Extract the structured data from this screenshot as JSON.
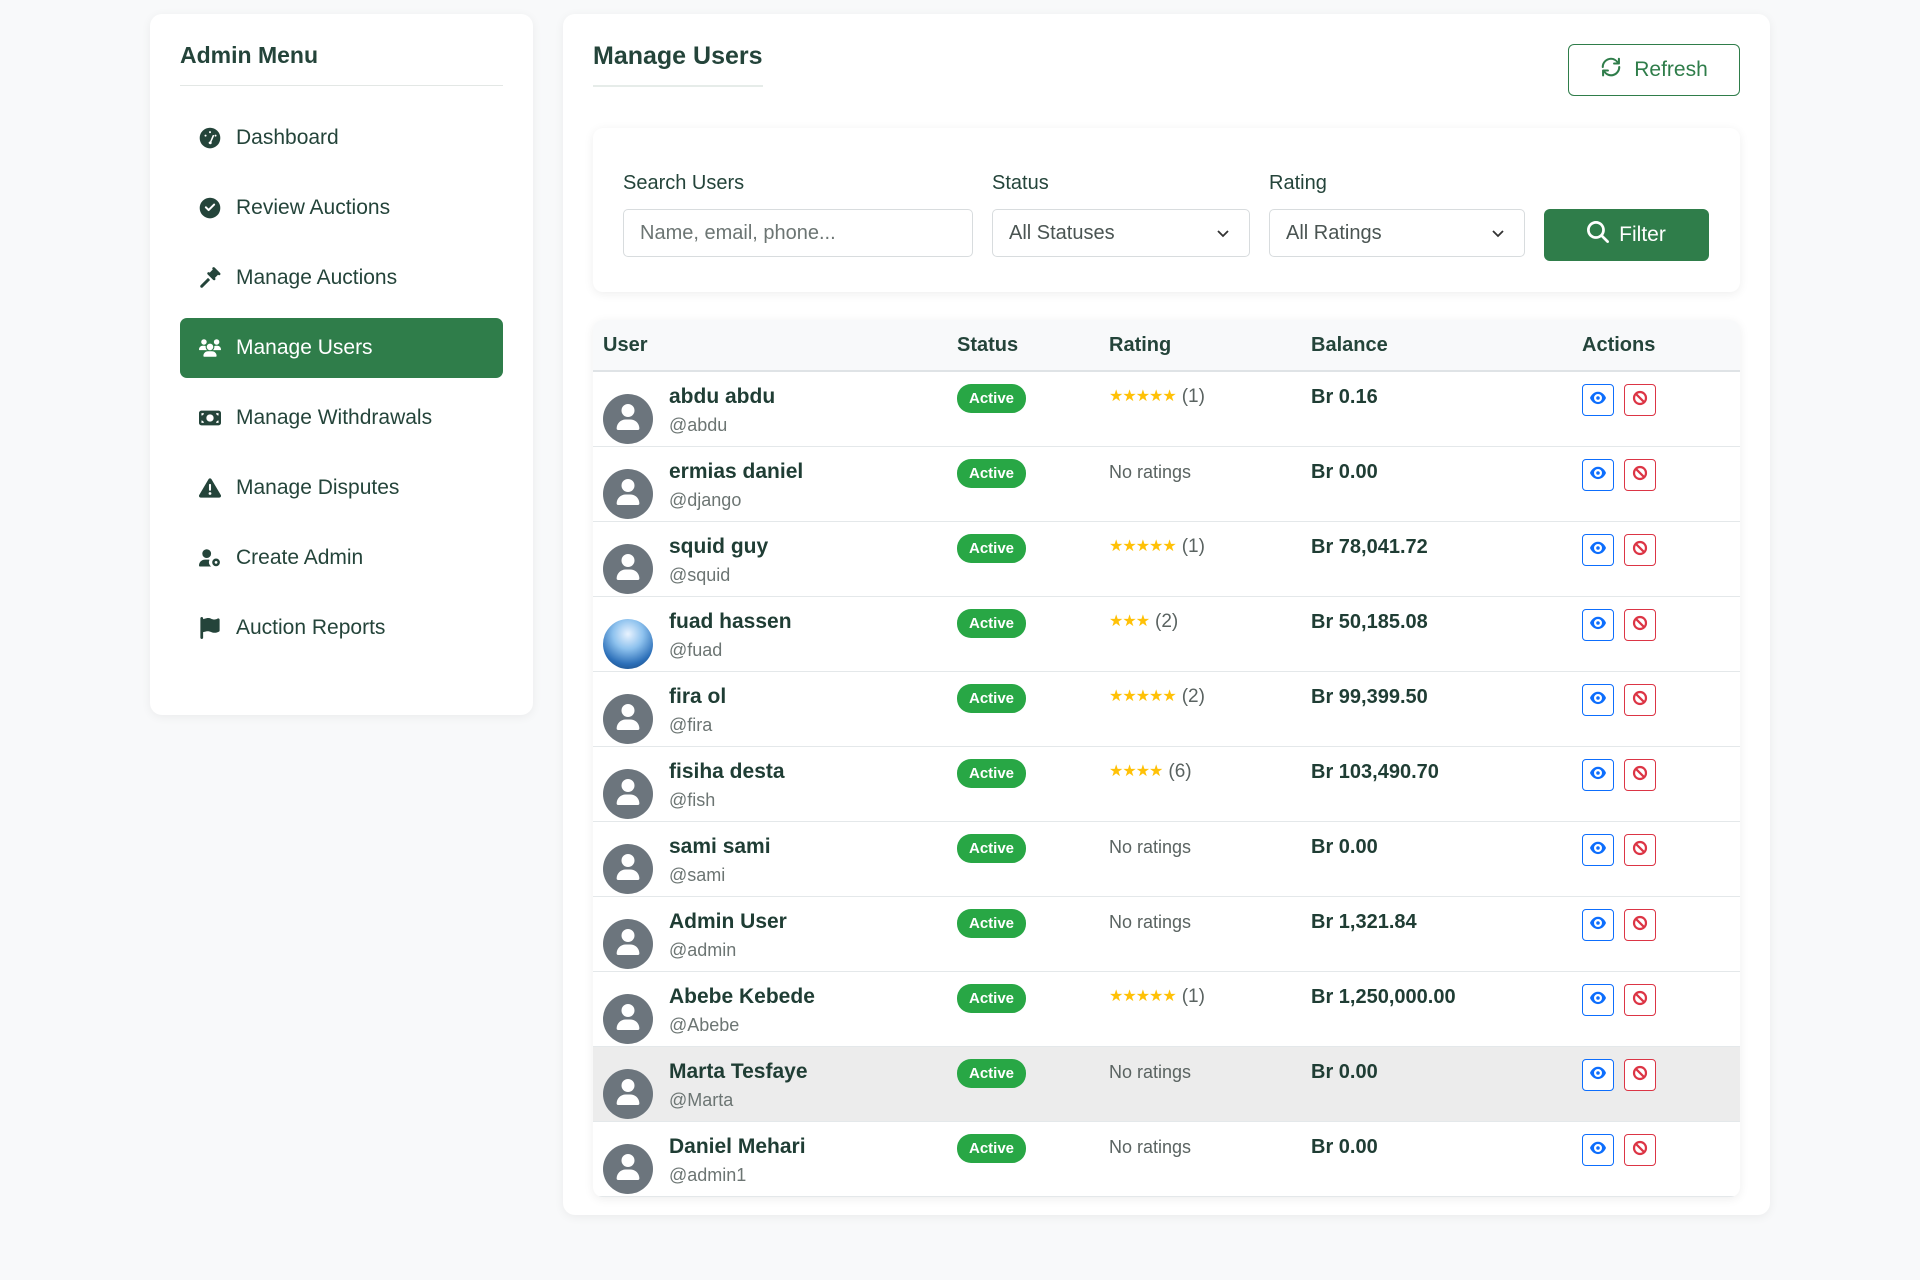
{
  "sidebar": {
    "title": "Admin Menu",
    "items": [
      {
        "label": "Dashboard",
        "icon": "dashboard-icon",
        "active": false
      },
      {
        "label": "Review Auctions",
        "icon": "check-circle-icon",
        "active": false
      },
      {
        "label": "Manage Auctions",
        "icon": "gavel-icon",
        "active": false
      },
      {
        "label": "Manage Users",
        "icon": "users-icon",
        "active": true
      },
      {
        "label": "Manage Withdrawals",
        "icon": "money-icon",
        "active": false
      },
      {
        "label": "Manage Disputes",
        "icon": "warning-icon",
        "active": false
      },
      {
        "label": "Create Admin",
        "icon": "user-cog-icon",
        "active": false
      },
      {
        "label": "Auction Reports",
        "icon": "flag-icon",
        "active": false
      }
    ]
  },
  "main": {
    "title": "Manage Users",
    "refresh_label": "Refresh"
  },
  "filters": {
    "search_label": "Search Users",
    "search_placeholder": "Name, email, phone...",
    "status_label": "Status",
    "status_value": "All Statuses",
    "rating_label": "Rating",
    "rating_value": "All Ratings",
    "filter_label": "Filter"
  },
  "table": {
    "headers": {
      "user": "User",
      "status": "Status",
      "rating": "Rating",
      "balance": "Balance",
      "actions": "Actions"
    },
    "rows": [
      {
        "name": "abdu abdu",
        "handle": "@abdu",
        "status": "Active",
        "stars": "★★★★★",
        "rating_count": "(1)",
        "no_ratings": "",
        "balance": "Br 0.16",
        "avatar": "default"
      },
      {
        "name": "ermias daniel",
        "handle": "@django",
        "status": "Active",
        "stars": "",
        "rating_count": "",
        "no_ratings": "No ratings",
        "balance": "Br 0.00",
        "avatar": "default"
      },
      {
        "name": "squid guy",
        "handle": "@squid",
        "status": "Active",
        "stars": "★★★★★",
        "rating_count": "(1)",
        "no_ratings": "",
        "balance": "Br 78,041.72",
        "avatar": "default"
      },
      {
        "name": "fuad hassen",
        "handle": "@fuad",
        "status": "Active",
        "stars": "★★★",
        "rating_count": "(2)",
        "no_ratings": "",
        "balance": "Br 50,185.08",
        "avatar": "photo"
      },
      {
        "name": "fira ol",
        "handle": "@fira",
        "status": "Active",
        "stars": "★★★★★",
        "rating_count": "(2)",
        "no_ratings": "",
        "balance": "Br 99,399.50",
        "avatar": "default"
      },
      {
        "name": "fisiha desta",
        "handle": "@fish",
        "status": "Active",
        "stars": "★★★★",
        "rating_count": "(6)",
        "no_ratings": "",
        "balance": "Br 103,490.70",
        "avatar": "default"
      },
      {
        "name": "sami sami",
        "handle": "@sami",
        "status": "Active",
        "stars": "",
        "rating_count": "",
        "no_ratings": "No ratings",
        "balance": "Br 0.00",
        "avatar": "default"
      },
      {
        "name": "Admin User",
        "handle": "@admin",
        "status": "Active",
        "stars": "",
        "rating_count": "",
        "no_ratings": "No ratings",
        "balance": "Br 1,321.84",
        "avatar": "default"
      },
      {
        "name": "Abebe Kebede",
        "handle": "@Abebe",
        "status": "Active",
        "stars": "★★★★★",
        "rating_count": "(1)",
        "no_ratings": "",
        "balance": "Br 1,250,000.00",
        "avatar": "default"
      },
      {
        "name": "Marta Tesfaye",
        "handle": "@Marta",
        "status": "Active",
        "stars": "",
        "rating_count": "",
        "no_ratings": "No ratings",
        "balance": "Br 0.00",
        "avatar": "default",
        "hover": true
      },
      {
        "name": "Daniel Mehari",
        "handle": "@admin1",
        "status": "Active",
        "stars": "",
        "rating_count": "",
        "no_ratings": "No ratings",
        "balance": "Br 0.00",
        "avatar": "default"
      }
    ]
  },
  "colors": {
    "brand_green": "#2f7d4a",
    "badge_green": "#28a745",
    "star_yellow": "#ffc107",
    "view_blue": "#0d6efd",
    "ban_red": "#dc3545"
  }
}
